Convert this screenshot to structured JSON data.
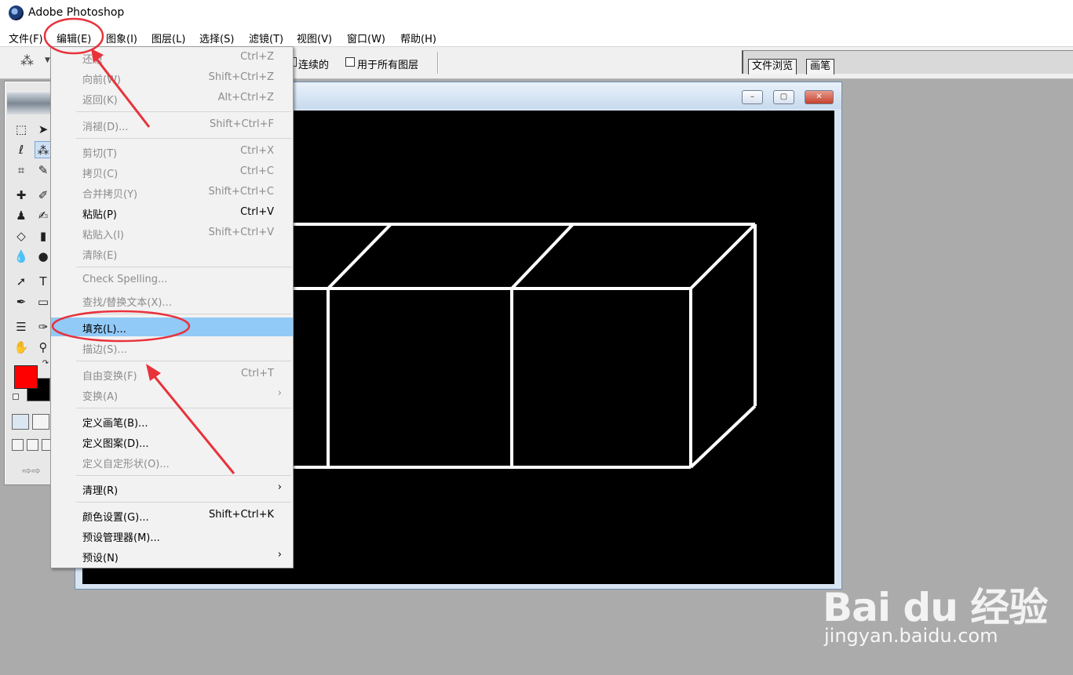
{
  "app": {
    "title": "Adobe Photoshop"
  },
  "menubar": [
    {
      "id": "file",
      "label": "文件(F)"
    },
    {
      "id": "edit",
      "label": "编辑(E)"
    },
    {
      "id": "image",
      "label": "图象(I)"
    },
    {
      "id": "layer",
      "label": "图层(L)"
    },
    {
      "id": "select",
      "label": "选择(S)"
    },
    {
      "id": "filter",
      "label": "滤镜(T)"
    },
    {
      "id": "view",
      "label": "视图(V)"
    },
    {
      "id": "window",
      "label": "窗口(W)"
    },
    {
      "id": "help",
      "label": "帮助(H)"
    }
  ],
  "options": {
    "contiguous_label": "连续的",
    "all_layers_label": "用于所有图层"
  },
  "palette_well": {
    "tabs": [
      "文件浏览",
      "画笔"
    ]
  },
  "colors": {
    "foreground": "#ff0000",
    "background": "#000000",
    "highlight": "#91c9f7",
    "annotation": "#e8323b"
  },
  "edit_menu": {
    "items": [
      {
        "label": "还原",
        "shortcut": "Ctrl+Z",
        "enabled": false
      },
      {
        "label": "向前(W)",
        "shortcut": "Shift+Ctrl+Z",
        "enabled": false
      },
      {
        "label": "返回(K)",
        "shortcut": "Alt+Ctrl+Z",
        "enabled": false
      },
      {
        "separator": true
      },
      {
        "label": "消褪(D)...",
        "shortcut": "Shift+Ctrl+F",
        "enabled": false
      },
      {
        "separator": true
      },
      {
        "label": "剪切(T)",
        "shortcut": "Ctrl+X",
        "enabled": false
      },
      {
        "label": "拷贝(C)",
        "shortcut": "Ctrl+C",
        "enabled": false
      },
      {
        "label": "合并拷贝(Y)",
        "shortcut": "Shift+Ctrl+C",
        "enabled": false
      },
      {
        "label": "粘贴(P)",
        "shortcut": "Ctrl+V",
        "enabled": true
      },
      {
        "label": "粘贴入(I)",
        "shortcut": "Shift+Ctrl+V",
        "enabled": false
      },
      {
        "label": "清除(E)",
        "shortcut": "",
        "enabled": false
      },
      {
        "separator": true
      },
      {
        "label": "Check Spelling...",
        "shortcut": "",
        "enabled": false
      },
      {
        "label": "查找/替换文本(X)...",
        "shortcut": "",
        "enabled": false
      },
      {
        "separator": true
      },
      {
        "label": "填充(L)...",
        "shortcut": "",
        "enabled": true,
        "highlighted": true
      },
      {
        "label": "描边(S)...",
        "shortcut": "",
        "enabled": false
      },
      {
        "separator": true
      },
      {
        "label": "自由变换(F)",
        "shortcut": "Ctrl+T",
        "enabled": false
      },
      {
        "label": "变换(A)",
        "shortcut": "",
        "enabled": false,
        "submenu": true
      },
      {
        "separator": true
      },
      {
        "label": "定义画笔(B)...",
        "shortcut": "",
        "enabled": true
      },
      {
        "label": "定义图案(D)...",
        "shortcut": "",
        "enabled": true
      },
      {
        "label": "定义自定形状(O)...",
        "shortcut": "",
        "enabled": false
      },
      {
        "separator": true
      },
      {
        "label": "清理(R)",
        "shortcut": "",
        "enabled": true,
        "submenu": true
      },
      {
        "separator": true
      },
      {
        "label": "颜色设置(G)...",
        "shortcut": "Shift+Ctrl+K",
        "enabled": true
      },
      {
        "label": "预设管理器(M)...",
        "shortcut": "",
        "enabled": true
      },
      {
        "label": "预设(N)",
        "shortcut": "",
        "enabled": true,
        "submenu": true
      }
    ]
  },
  "document": {
    "canvas_background": "#000000",
    "line_color": "#ffffff"
  },
  "watermark": {
    "logo": "Bai du 经验",
    "url": "jingyan.baidu.com"
  }
}
